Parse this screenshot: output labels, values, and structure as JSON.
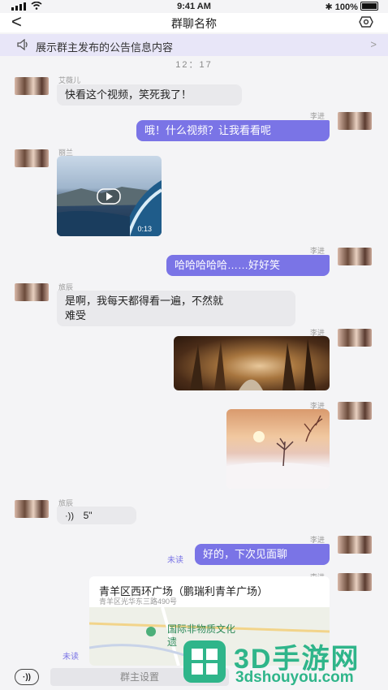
{
  "status": {
    "time": "9:41 AM",
    "battery": "100%",
    "bluetooth": "✱"
  },
  "nav": {
    "back": "<",
    "title": "群聊名称"
  },
  "notice": {
    "text": "展示群主发布的公告信息内容",
    "chevron": ">"
  },
  "timestamp": "12：17",
  "messages": [
    {
      "sender": "艾薇儿",
      "text": "快看这个视频，笑死我了！"
    },
    {
      "sender": "李进",
      "text": "哦！什么视频？让我看看呢"
    },
    {
      "sender": "丽兰",
      "video_duration": "0:13"
    },
    {
      "sender": "李进",
      "text": "哈哈哈哈哈……好好笑"
    },
    {
      "sender": "旅辰",
      "text_line1": "是啊，我每天都得看一遍，不然就",
      "text_line2": "难受"
    },
    {
      "sender": "李进",
      "image": "forest-path"
    },
    {
      "sender": "李进",
      "image": "winter-sunset"
    },
    {
      "sender": "旅辰",
      "voice": "5\""
    },
    {
      "sender": "李进",
      "text": "好的，下次见面聊",
      "status": "未读"
    },
    {
      "sender": "李进",
      "location_title": "青羊区西环广场（鹏瑞利青羊广场）",
      "location_addr": "青羊区光华东三路490号",
      "map_label_1": "国际非物质文化",
      "map_label_2": "遗",
      "status": "未读"
    }
  ],
  "input": {
    "placeholder": "群主设置"
  },
  "watermark": {
    "brand": "3D手游网",
    "url": "3dshouyou.com"
  },
  "colors": {
    "accent": "#7a74e6",
    "notice_bg": "#e8e6f8"
  }
}
